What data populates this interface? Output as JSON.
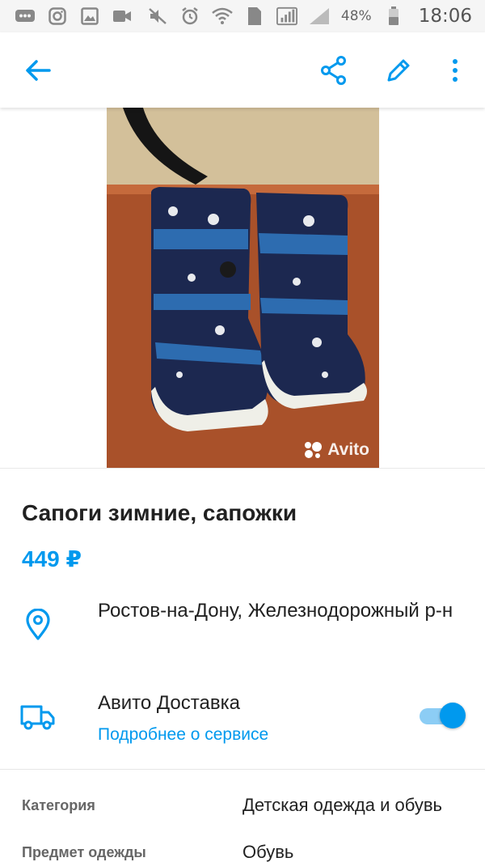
{
  "status_bar": {
    "left_icons": [
      "messages-icon",
      "instagram-icon",
      "gallery-icon",
      "video-icon"
    ],
    "right_icons": [
      "mute-icon",
      "alarm-icon",
      "wifi-icon",
      "sim-icon",
      "signal-icon"
    ],
    "sim_number": "1",
    "battery": "48%",
    "time": "18:06"
  },
  "toolbar": {
    "back_icon": "arrow-left-icon",
    "share_icon": "share-icon",
    "edit_icon": "pencil-icon",
    "more_icon": "more-vert-icon",
    "accent": "#0099ee"
  },
  "photo": {
    "description_icon": "photo",
    "watermark": "Avito"
  },
  "listing": {
    "title": "Сапоги зимние, сапожки",
    "price": "449 ₽",
    "location": "Ростов-на-Дону, Железнодорожный р-н",
    "delivery_title": "Авито Доставка",
    "delivery_link": "Подробнее о сервисе",
    "delivery_enabled": true
  },
  "properties": [
    {
      "label": "Категория",
      "value": "Детская одежда и обувь"
    },
    {
      "label": "Предмет одежды",
      "value": "Обувь"
    }
  ],
  "colors": {
    "accent": "#0099ee",
    "text": "#212121",
    "muted": "#666666"
  }
}
